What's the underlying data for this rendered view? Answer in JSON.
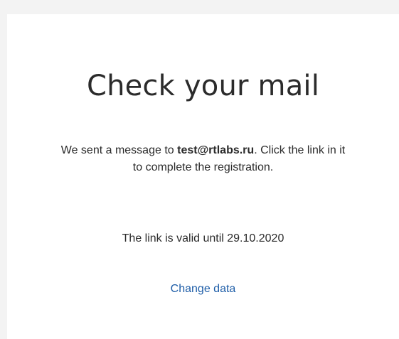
{
  "page": {
    "title": "Check your mail",
    "message_prefix": "We sent a message to ",
    "email": "test@rtlabs.ru",
    "message_suffix": ". Click the link in it to complete the registration.",
    "validity": "The link is valid until 29.10.2020",
    "change_data_link": "Change data"
  },
  "colors": {
    "background": "#f3f3f3",
    "card": "#ffffff",
    "text": "#2b2b2b",
    "link": "#1f5ea8"
  }
}
